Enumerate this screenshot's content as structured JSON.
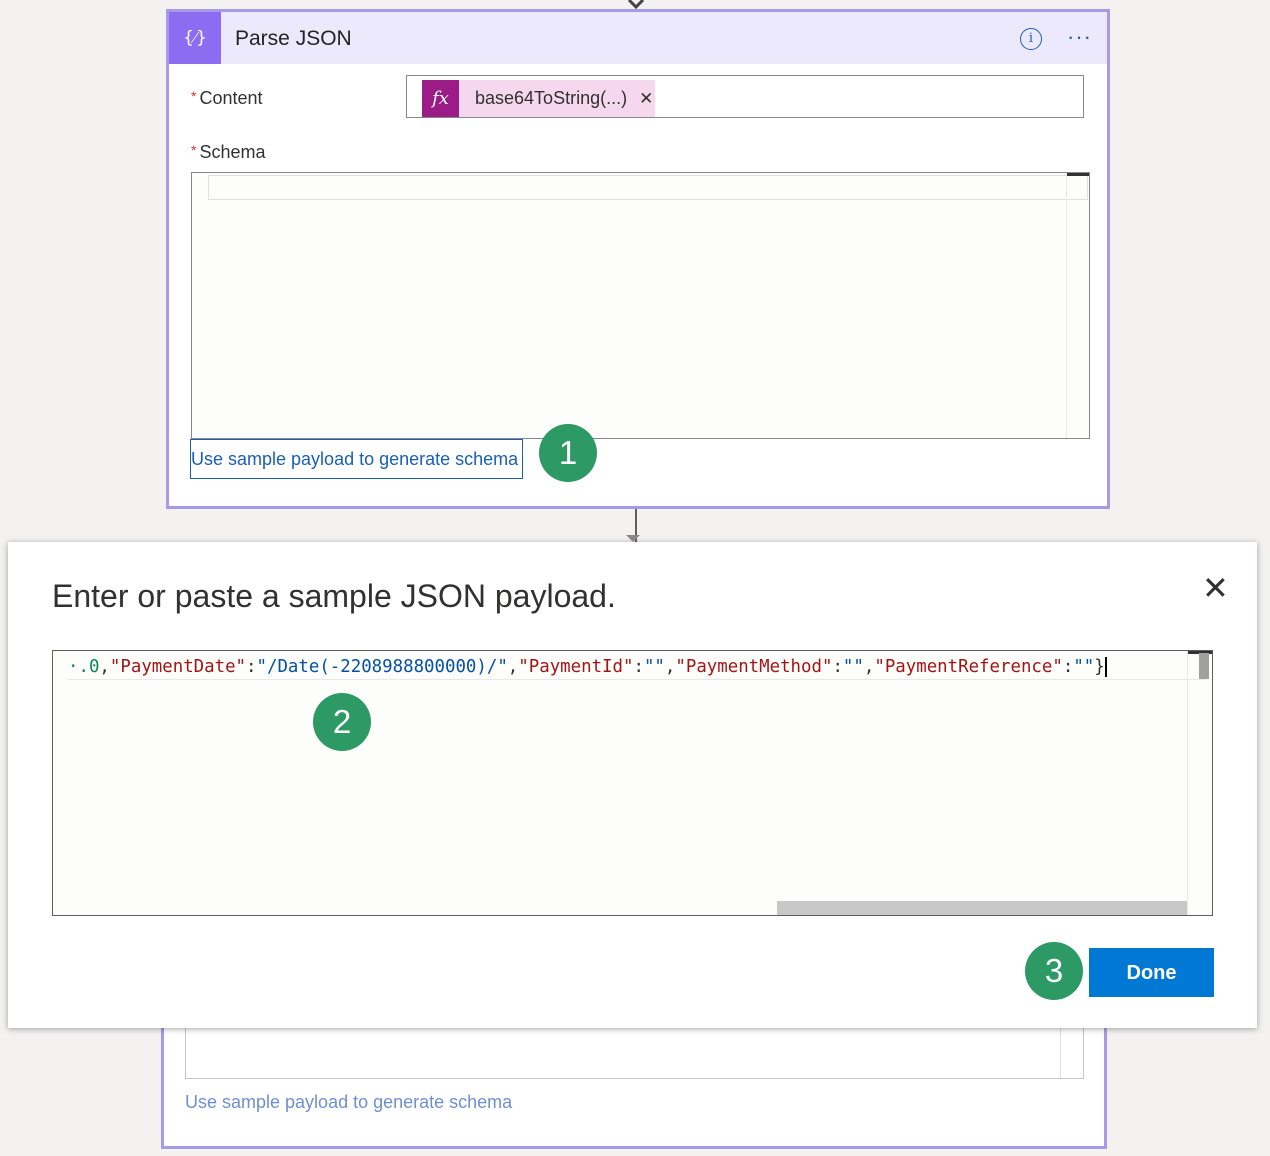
{
  "card": {
    "icon": "{⁄}",
    "title": "Parse JSON",
    "info_icon": "i",
    "more_icon": "···",
    "content_label": "Content",
    "content_token": {
      "fx_icon": "fx",
      "label": "base64ToString(...)",
      "remove_icon": "✕"
    },
    "schema_label": "Schema",
    "schema_value": "",
    "sample_link": "Use sample payload to generate schema",
    "required_marker": "*"
  },
  "badges": [
    "1",
    "2",
    "3"
  ],
  "lower_card": {
    "sample_link": "Use sample payload to generate schema"
  },
  "dialog": {
    "title": "Enter or paste a sample JSON payload.",
    "close_icon": "✕",
    "payload_tokens": [
      {
        "t": "num",
        "v": "·.0"
      },
      {
        "t": "punc",
        "v": ","
      },
      {
        "t": "key",
        "v": "\"PaymentDate\""
      },
      {
        "t": "punc",
        "v": ":"
      },
      {
        "t": "str",
        "v": "\"/Date(-2208988800000)/\""
      },
      {
        "t": "punc",
        "v": ","
      },
      {
        "t": "key",
        "v": "\"PaymentId\""
      },
      {
        "t": "punc",
        "v": ":"
      },
      {
        "t": "str",
        "v": "\"\""
      },
      {
        "t": "punc",
        "v": ","
      },
      {
        "t": "key",
        "v": "\"PaymentMethod\""
      },
      {
        "t": "punc",
        "v": ":"
      },
      {
        "t": "str",
        "v": "\"\""
      },
      {
        "t": "punc",
        "v": ","
      },
      {
        "t": "key",
        "v": "\"PaymentReference\""
      },
      {
        "t": "punc",
        "v": ":"
      },
      {
        "t": "str",
        "v": "\"\""
      },
      {
        "t": "punc",
        "v": "}"
      }
    ],
    "done_label": "Done"
  },
  "colors": {
    "accent": "#0078d4",
    "card_border": "#a79be8",
    "header_bg": "#ede9fd",
    "icon_bg": "#8c6cf0",
    "token_bg": "#f5d8ee",
    "fx_bg": "#9b1c86",
    "badge": "#2d9964",
    "link": "#1a5fb4"
  }
}
